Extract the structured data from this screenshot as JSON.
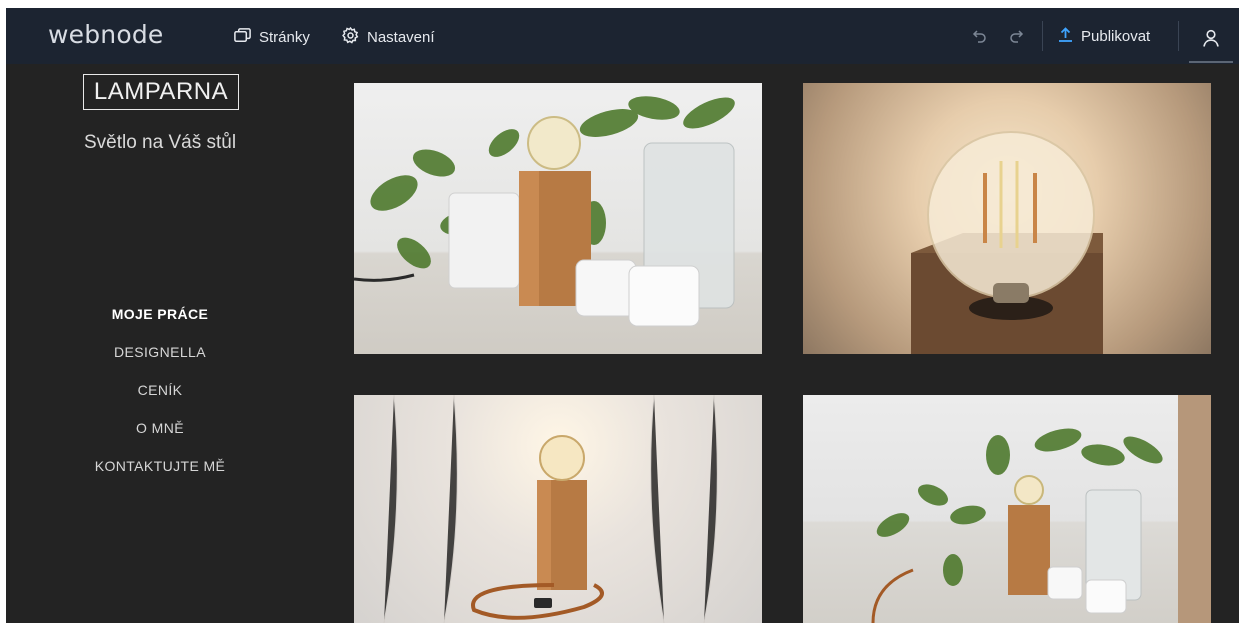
{
  "topbar": {
    "brand": "webnode",
    "pages_label": "Stránky",
    "settings_label": "Nastavení",
    "publish_label": "Publikovat"
  },
  "site": {
    "logo_text": "LAMPARNA",
    "tagline": "Světlo na Váš stůl",
    "menu": [
      {
        "label": "MOJE PRÁCE",
        "active": true
      },
      {
        "label": "DESIGNELLA",
        "active": false
      },
      {
        "label": "CENÍK",
        "active": false
      },
      {
        "label": "O MNĚ",
        "active": false
      },
      {
        "label": "KONTAKTUJTE MĚ",
        "active": false
      }
    ]
  },
  "colors": {
    "topbar_bg": "#1c2431",
    "page_bg": "#232323",
    "accent": "#3fa4ff"
  },
  "icons": [
    "pages-icon",
    "settings-gear-icon",
    "undo-icon",
    "redo-icon",
    "upload-icon",
    "user-icon"
  ]
}
